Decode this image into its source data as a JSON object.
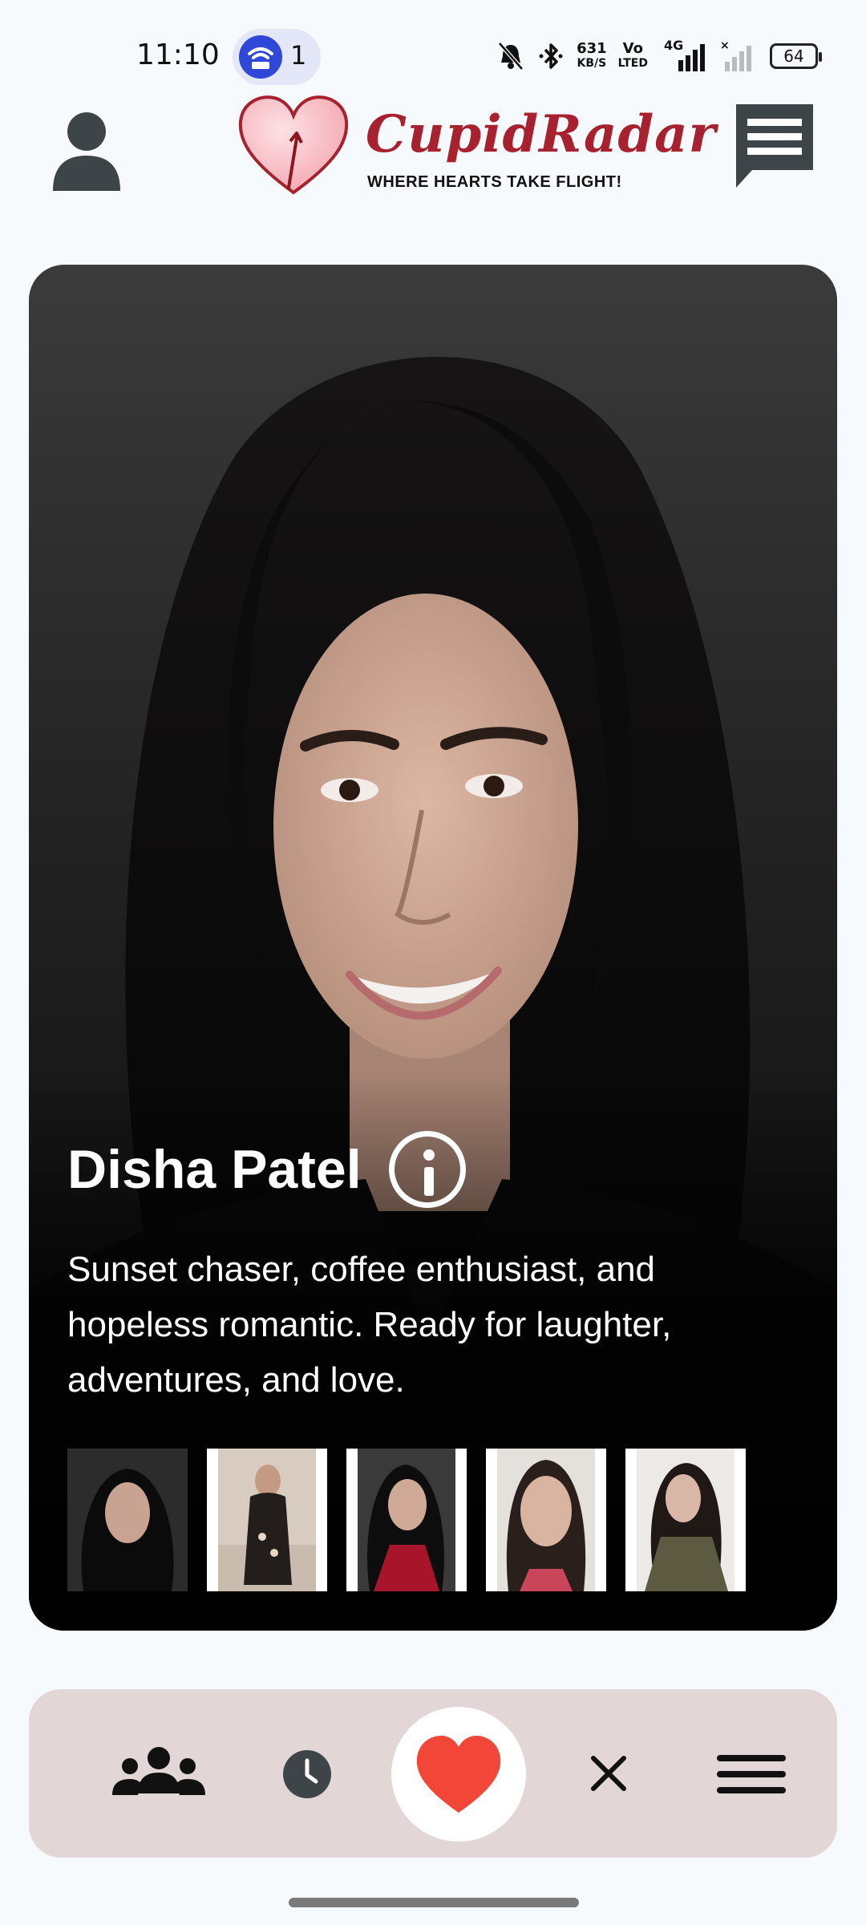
{
  "status_bar": {
    "time": "11:10",
    "hotspot_count": "1",
    "net_speed_value": "631",
    "net_speed_unit": "KB/S",
    "volte_top": "Vo",
    "volte_bottom": "LTED",
    "network_type": "4G",
    "battery": "64",
    "icons": [
      "wifi-hotspot-icon",
      "mute-bell-icon",
      "bluetooth-icon",
      "signal-icon",
      "battery-icon"
    ]
  },
  "header": {
    "app_name": "CupidRadar",
    "tagline": "WHERE HEARTS TAKE FLIGHT!",
    "icons": [
      "profile-icon",
      "chat-icon",
      "heart-logo-icon"
    ]
  },
  "profile": {
    "name": "Disha Patel",
    "bio": "Sunset chaser, coffee enthusiast, and hopeless romantic. Ready for laughter, adventures, and love.",
    "photo_count": 5,
    "info_icon": "info-icon"
  },
  "bottom_nav": {
    "items": [
      {
        "name": "people-icon"
      },
      {
        "name": "clock-icon"
      },
      {
        "name": "heart-icon",
        "color": "#f24638"
      },
      {
        "name": "close-icon"
      },
      {
        "name": "menu-icon"
      }
    ]
  },
  "colors": {
    "brand": "#a8212e",
    "like": "#f24638",
    "nav_bg": "#e2d6d6",
    "background": "#f7fafc"
  }
}
